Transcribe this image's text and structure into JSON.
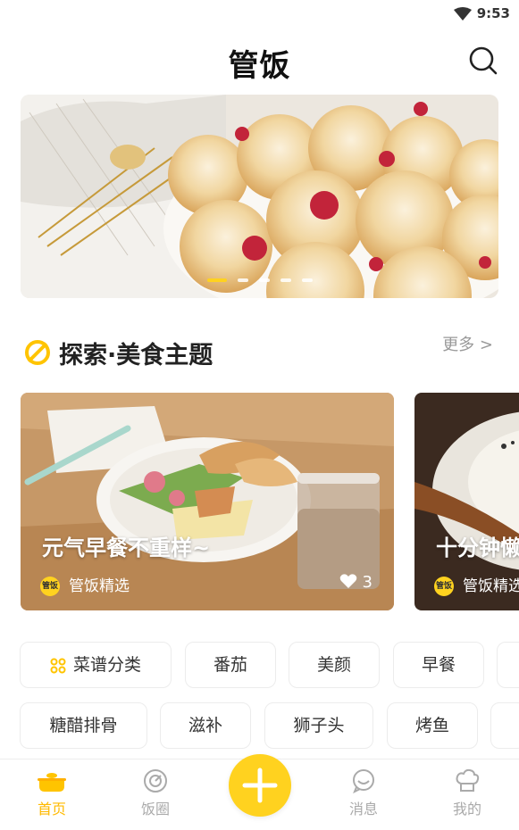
{
  "status": {
    "time": "9:53"
  },
  "header": {
    "logo_text": "管饭"
  },
  "banner": {
    "slide_count": 5,
    "active_slide": 0
  },
  "section": {
    "title": "探索·美食主题",
    "more_label": "更多 >"
  },
  "cards": [
    {
      "title": "元气早餐不重样~",
      "author": "管饭精选",
      "likes": "3"
    },
    {
      "title": "十分钟懒",
      "author": "管饭精选"
    }
  ],
  "mini_logo_text": "管饭",
  "tags_row1": [
    {
      "label": "菜谱分类"
    },
    {
      "label": "番茄"
    },
    {
      "label": "美颜"
    },
    {
      "label": "早餐"
    }
  ],
  "tags_row2": [
    {
      "label": "糖醋排骨"
    },
    {
      "label": "滋补"
    },
    {
      "label": "狮子头"
    },
    {
      "label": "烤鱼"
    }
  ],
  "nav": {
    "home": "首页",
    "circle": "饭圈",
    "messages": "消息",
    "mine": "我的"
  },
  "colors": {
    "accent": "#ffd21f",
    "active_nav": "#ffba00"
  }
}
